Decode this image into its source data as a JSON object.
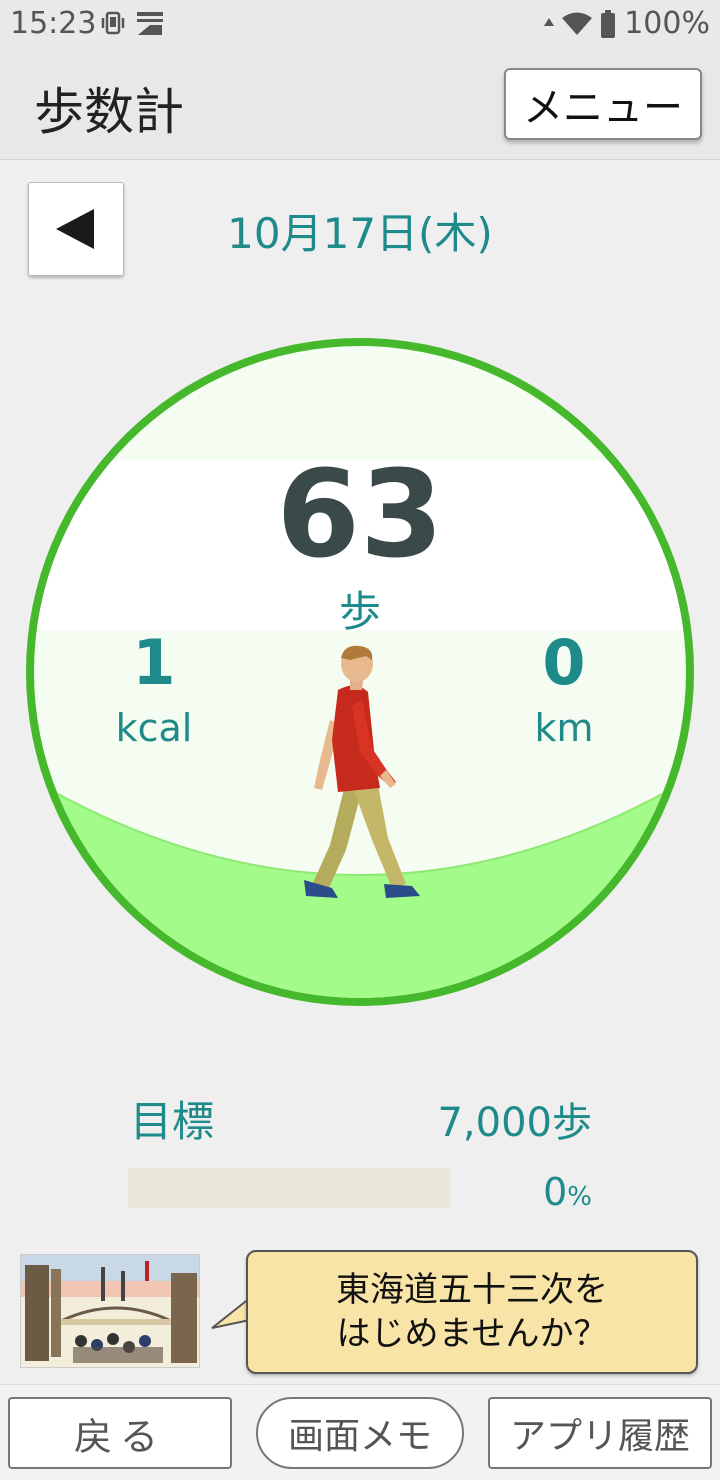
{
  "status_bar": {
    "time": "15:23",
    "battery": "100%",
    "icons": [
      "vibrate-icon",
      "personal-screen-icon",
      "data-arrow-icon",
      "wifi-icon",
      "battery-icon"
    ]
  },
  "header": {
    "title": "歩数計",
    "menu_label": "メニュー"
  },
  "date_nav": {
    "prev_icon": "left-triangle-icon",
    "date": "10月17日(木)"
  },
  "stats": {
    "steps": "63",
    "steps_unit": "歩",
    "kcal": "1",
    "kcal_unit": "kcal",
    "km": "0",
    "km_unit": "km"
  },
  "goal": {
    "label": "目標",
    "value": "7,000歩",
    "percent_number": "0",
    "percent_sign": "%",
    "progress": 0
  },
  "promo": {
    "line1": "東海道五十三次を",
    "line2": "はじめませんか？"
  },
  "bottom_nav": {
    "back": "戻る",
    "memo": "画面メモ",
    "history": "アプリ履歴"
  },
  "colors": {
    "accent": "#1e8a8a",
    "ring": "#45b82c",
    "ground": "#a3fc8a",
    "value_dark": "#3a4a4a"
  }
}
